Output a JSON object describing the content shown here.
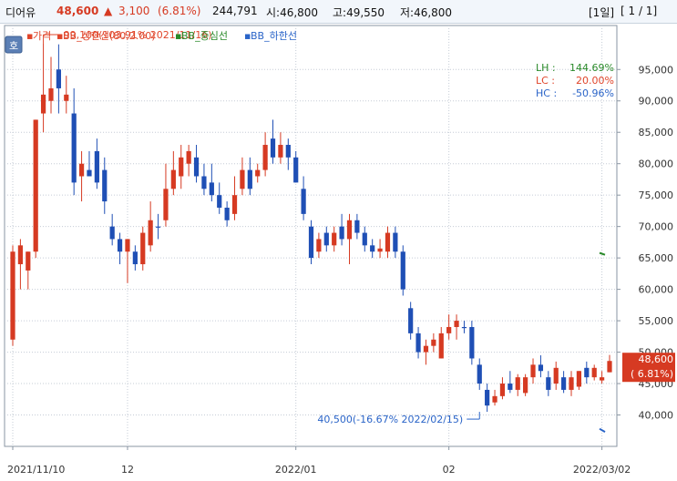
{
  "header": {
    "name": "디어유",
    "price": "48,600",
    "change_arrow": "▲",
    "change": "3,100",
    "change_pct": "(6.81%)",
    "volume": "244,791",
    "open": "시:46,800",
    "high": "고:49,550",
    "low": "저:46,800",
    "period": "[1일]",
    "page": "[ 1 / 1]"
  },
  "side_button": "호",
  "legend": [
    {
      "label": "가격",
      "color": "#e0452a"
    },
    {
      "label": "BB_상한선(80,2.00)",
      "color": "#e0452a"
    },
    {
      "label": "BB_중심선",
      "color": "#2a8a2a"
    },
    {
      "label": "BB_하한선",
      "color": "#2a64c8"
    }
  ],
  "stats": [
    {
      "label": "LH :",
      "value": "144.69%",
      "color": "#2a8a2a"
    },
    {
      "label": "LC :",
      "value": "20.00%",
      "color": "#e0452a"
    },
    {
      "label": "HC :",
      "value": "-50.96%",
      "color": "#2a64c8"
    }
  ],
  "price_tag": {
    "value": "48,600",
    "pct": "( 6.81%)",
    "color": "#d63a22"
  },
  "chart_data": {
    "type": "candlestick",
    "ylim": [
      35000,
      102000
    ],
    "y_ticks": [
      {
        "value": 40000,
        "label": "40,000"
      },
      {
        "value": 45000,
        "label": "45,000"
      },
      {
        "value": 50000,
        "label": "50,000"
      },
      {
        "value": 55000,
        "label": "55,000"
      },
      {
        "value": 60000,
        "label": "60,000"
      },
      {
        "value": 65000,
        "label": "65,000"
      },
      {
        "value": 70000,
        "label": "70,000"
      },
      {
        "value": 75000,
        "label": "75,000"
      },
      {
        "value": 80000,
        "label": "80,000"
      },
      {
        "value": 85000,
        "label": "85,000"
      },
      {
        "value": 90000,
        "label": "90,000"
      },
      {
        "value": 95000,
        "label": "95,000"
      }
    ],
    "x_ticks": [
      {
        "index": 0,
        "label": "2021/11/10"
      },
      {
        "index": 15,
        "label": "12"
      },
      {
        "index": 37,
        "label": "2022/01"
      },
      {
        "index": 57,
        "label": "02"
      },
      {
        "index": 77,
        "label": "2022/03/02"
      }
    ],
    "candles": [
      {
        "o": 52000,
        "h": 67000,
        "l": 51000,
        "c": 66000,
        "up": true
      },
      {
        "o": 64000,
        "h": 68000,
        "l": 60000,
        "c": 67000,
        "up": true
      },
      {
        "o": 63000,
        "h": 66000,
        "l": 60000,
        "c": 66000,
        "up": true
      },
      {
        "o": 66000,
        "h": 87000,
        "l": 65000,
        "c": 87000,
        "up": true
      },
      {
        "o": 88000,
        "h": 99100,
        "l": 85000,
        "c": 91000,
        "up": true
      },
      {
        "o": 90000,
        "h": 97000,
        "l": 88000,
        "c": 92000,
        "up": true
      },
      {
        "o": 95000,
        "h": 99000,
        "l": 88000,
        "c": 92000,
        "up": false
      },
      {
        "o": 90000,
        "h": 94000,
        "l": 88000,
        "c": 91000,
        "up": true
      },
      {
        "o": 88000,
        "h": 92000,
        "l": 75000,
        "c": 77000,
        "up": false
      },
      {
        "o": 78000,
        "h": 82000,
        "l": 74000,
        "c": 80000,
        "up": true
      },
      {
        "o": 79000,
        "h": 82000,
        "l": 78000,
        "c": 78000,
        "up": false
      },
      {
        "o": 82000,
        "h": 84000,
        "l": 76000,
        "c": 77000,
        "up": false
      },
      {
        "o": 79000,
        "h": 81000,
        "l": 72000,
        "c": 74000,
        "up": false
      },
      {
        "o": 70000,
        "h": 72000,
        "l": 67000,
        "c": 68000,
        "up": false
      },
      {
        "o": 68000,
        "h": 69000,
        "l": 64000,
        "c": 66000,
        "up": false
      },
      {
        "o": 66000,
        "h": 68000,
        "l": 61000,
        "c": 68000,
        "up": true
      },
      {
        "o": 66000,
        "h": 67000,
        "l": 63000,
        "c": 64000,
        "up": false
      },
      {
        "o": 64000,
        "h": 70000,
        "l": 63000,
        "c": 69000,
        "up": true
      },
      {
        "o": 67000,
        "h": 74000,
        "l": 66000,
        "c": 71000,
        "up": true
      },
      {
        "o": 70000,
        "h": 72000,
        "l": 68000,
        "c": 70000,
        "up": false
      },
      {
        "o": 71000,
        "h": 80000,
        "l": 70000,
        "c": 76000,
        "up": true
      },
      {
        "o": 76000,
        "h": 82000,
        "l": 75000,
        "c": 79000,
        "up": true
      },
      {
        "o": 78000,
        "h": 83000,
        "l": 76000,
        "c": 81000,
        "up": true
      },
      {
        "o": 80000,
        "h": 83000,
        "l": 78000,
        "c": 82000,
        "up": true
      },
      {
        "o": 81000,
        "h": 83000,
        "l": 77000,
        "c": 78000,
        "up": false
      },
      {
        "o": 78000,
        "h": 80000,
        "l": 75000,
        "c": 76000,
        "up": false
      },
      {
        "o": 77000,
        "h": 80000,
        "l": 74000,
        "c": 75000,
        "up": false
      },
      {
        "o": 75000,
        "h": 77000,
        "l": 72000,
        "c": 73000,
        "up": false
      },
      {
        "o": 73000,
        "h": 74000,
        "l": 70000,
        "c": 71000,
        "up": false
      },
      {
        "o": 72000,
        "h": 78000,
        "l": 71000,
        "c": 75000,
        "up": true
      },
      {
        "o": 76000,
        "h": 81000,
        "l": 75000,
        "c": 79000,
        "up": true
      },
      {
        "o": 79000,
        "h": 81000,
        "l": 75000,
        "c": 76000,
        "up": false
      },
      {
        "o": 78000,
        "h": 80000,
        "l": 77000,
        "c": 79000,
        "up": true
      },
      {
        "o": 79000,
        "h": 85000,
        "l": 78000,
        "c": 83000,
        "up": true
      },
      {
        "o": 84000,
        "h": 87000,
        "l": 80000,
        "c": 81000,
        "up": false
      },
      {
        "o": 81000,
        "h": 85000,
        "l": 80000,
        "c": 83000,
        "up": true
      },
      {
        "o": 83000,
        "h": 84000,
        "l": 79000,
        "c": 81000,
        "up": false
      },
      {
        "o": 81000,
        "h": 82000,
        "l": 77000,
        "c": 77000,
        "up": false
      },
      {
        "o": 76000,
        "h": 78000,
        "l": 71000,
        "c": 72000,
        "up": false
      },
      {
        "o": 70000,
        "h": 71000,
        "l": 64000,
        "c": 65000,
        "up": false
      },
      {
        "o": 66000,
        "h": 69000,
        "l": 65000,
        "c": 68000,
        "up": true
      },
      {
        "o": 69000,
        "h": 70000,
        "l": 66000,
        "c": 67000,
        "up": false
      },
      {
        "o": 67000,
        "h": 70000,
        "l": 66000,
        "c": 69000,
        "up": true
      },
      {
        "o": 70000,
        "h": 72000,
        "l": 67000,
        "c": 68000,
        "up": false
      },
      {
        "o": 68000,
        "h": 72000,
        "l": 64000,
        "c": 71000,
        "up": true
      },
      {
        "o": 71000,
        "h": 72000,
        "l": 68000,
        "c": 69000,
        "up": false
      },
      {
        "o": 69000,
        "h": 70000,
        "l": 66000,
        "c": 67000,
        "up": false
      },
      {
        "o": 67000,
        "h": 68000,
        "l": 65000,
        "c": 66000,
        "up": false
      },
      {
        "o": 66000,
        "h": 68000,
        "l": 65000,
        "c": 66500,
        "up": true
      },
      {
        "o": 66000,
        "h": 70000,
        "l": 65000,
        "c": 69000,
        "up": true
      },
      {
        "o": 69000,
        "h": 70000,
        "l": 65000,
        "c": 66000,
        "up": false
      },
      {
        "o": 66000,
        "h": 67000,
        "l": 59000,
        "c": 60000,
        "up": false
      },
      {
        "o": 57000,
        "h": 58000,
        "l": 52000,
        "c": 53000,
        "up": false
      },
      {
        "o": 53000,
        "h": 54000,
        "l": 49000,
        "c": 50000,
        "up": false
      },
      {
        "o": 50000,
        "h": 52000,
        "l": 48000,
        "c": 51000,
        "up": true
      },
      {
        "o": 51000,
        "h": 53000,
        "l": 50000,
        "c": 52000,
        "up": true
      },
      {
        "o": 49000,
        "h": 54000,
        "l": 49000,
        "c": 53000,
        "up": true
      },
      {
        "o": 53000,
        "h": 56000,
        "l": 52000,
        "c": 54000,
        "up": true
      },
      {
        "o": 54000,
        "h": 56000,
        "l": 52000,
        "c": 55000,
        "up": true
      },
      {
        "o": 54000,
        "h": 55000,
        "l": 53000,
        "c": 54000,
        "up": false
      },
      {
        "o": 54000,
        "h": 55000,
        "l": 48000,
        "c": 49000,
        "up": false
      },
      {
        "o": 48000,
        "h": 49000,
        "l": 44000,
        "c": 45000,
        "up": false
      },
      {
        "o": 44000,
        "h": 45000,
        "l": 40500,
        "c": 41500,
        "up": false
      },
      {
        "o": 42000,
        "h": 44000,
        "l": 41500,
        "c": 43000,
        "up": true
      },
      {
        "o": 43000,
        "h": 46000,
        "l": 42500,
        "c": 45000,
        "up": true
      },
      {
        "o": 45000,
        "h": 47000,
        "l": 43500,
        "c": 44000,
        "up": false
      },
      {
        "o": 44000,
        "h": 46500,
        "l": 43000,
        "c": 46000,
        "up": true
      },
      {
        "o": 43500,
        "h": 46500,
        "l": 43000,
        "c": 46000,
        "up": true
      },
      {
        "o": 46000,
        "h": 49000,
        "l": 45000,
        "c": 48000,
        "up": true
      },
      {
        "o": 48000,
        "h": 49500,
        "l": 46000,
        "c": 47000,
        "up": false
      },
      {
        "o": 46000,
        "h": 47000,
        "l": 43000,
        "c": 44000,
        "up": false
      },
      {
        "o": 45000,
        "h": 48500,
        "l": 44000,
        "c": 47500,
        "up": true
      },
      {
        "o": 46000,
        "h": 47000,
        "l": 43500,
        "c": 44000,
        "up": false
      },
      {
        "o": 44000,
        "h": 47000,
        "l": 43000,
        "c": 46000,
        "up": true
      },
      {
        "o": 44500,
        "h": 47000,
        "l": 44000,
        "c": 47000,
        "up": true
      },
      {
        "o": 47500,
        "h": 48500,
        "l": 45000,
        "c": 46000,
        "up": false
      },
      {
        "o": 46000,
        "h": 48000,
        "l": 45500,
        "c": 47500,
        "up": true
      },
      {
        "o": 46000,
        "h": 47000,
        "l": 45000,
        "c": 45500,
        "up": true
      },
      {
        "o": 46800,
        "h": 49550,
        "l": 46800,
        "c": 48600,
        "up": true
      }
    ],
    "annotations": [
      {
        "text": "99,100(103.91% 2021/11/16)",
        "index": 4,
        "value": 99100,
        "color": "#e0452a",
        "position": "above"
      },
      {
        "text": "40,500(-16.67% 2022/02/15)",
        "index": 61,
        "value": 40500,
        "color": "#2a64c8",
        "position": "below"
      }
    ]
  }
}
